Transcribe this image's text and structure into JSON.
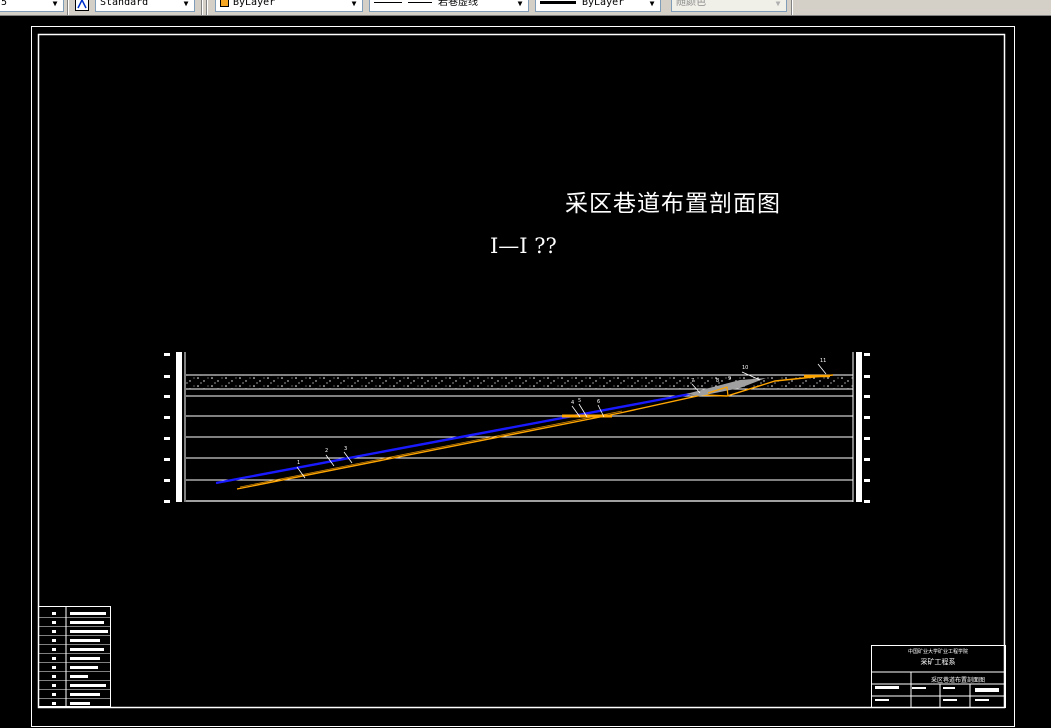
{
  "toolbar": {
    "combo_prev": "5",
    "text_style": "Standard",
    "color": "ByLayer",
    "color_swatch": "#f5a623",
    "linetype": "岩巷虚线",
    "lineweight": "ByLayer",
    "plot_style": "随颜色"
  },
  "drawing": {
    "title": "采区巷道布置剖面图",
    "section_label": "I—I ??",
    "colors": {
      "background": "#000000",
      "frame": "#ffffff",
      "roadway_blue": "#1a1aff",
      "roadway_orange": "#ffa500",
      "marker_gray": "#a0a0a0"
    },
    "leader_labels": [
      "1",
      "2",
      "3",
      "4",
      "5",
      "6",
      "7",
      "8",
      "9",
      "10",
      "11"
    ],
    "title_block": {
      "school": "中国矿业大学矿业工程学院",
      "department": "采矿工程系",
      "drawing_name": "采区巷道布置剖面图"
    }
  }
}
